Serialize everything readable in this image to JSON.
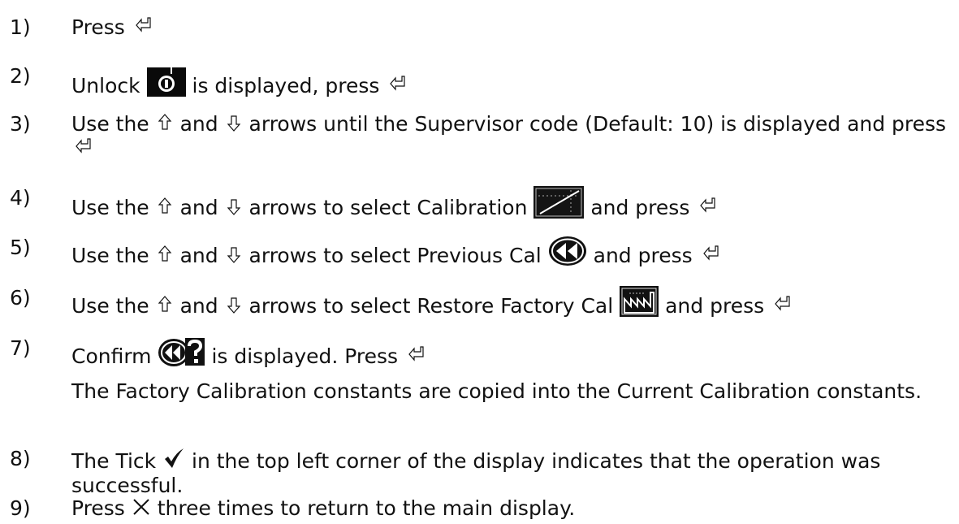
{
  "steps": [
    {
      "num": "1)",
      "parts": [
        "Press "
      ]
    },
    {
      "num": "2)",
      "parts": [
        "Unlock ",
        " is displayed, press "
      ]
    },
    {
      "num": "3)",
      "parts": [
        "Use the ",
        " and ",
        " arrows until the Supervisor code (Default: 10) is displayed and press "
      ]
    },
    {
      "num": "4)",
      "parts": [
        "Use the ",
        " and ",
        " arrows to select Calibration ",
        " and press "
      ]
    },
    {
      "num": "5)",
      "parts": [
        "Use the ",
        " and ",
        " arrows to select Previous Cal ",
        " and press "
      ]
    },
    {
      "num": "6)",
      "parts": [
        "Use the ",
        " and ",
        " arrows to select Restore Factory Cal ",
        " and press "
      ]
    },
    {
      "num": "7)",
      "parts": [
        "Confirm ",
        " is displayed. Press "
      ]
    },
    {
      "num": "8)",
      "parts": [
        "The Tick ",
        " in the top left corner of the display indicates that the operation was successful."
      ]
    },
    {
      "num": "9)",
      "parts": [
        "Press ",
        " three times to return to the main display."
      ]
    }
  ],
  "step7_note": "The Factory Calibration constants are copied into the Current Calibration constants.",
  "icons": {
    "enter": "enter-key-icon",
    "up": "up-arrow-icon",
    "down": "down-arrow-icon",
    "unlock": "unlock-padlock-icon",
    "calibration": "calibration-graph-icon",
    "previous_cal": "rewind-icon",
    "restore_factory": "factory-icon",
    "confirm": "confirm-question-icon",
    "tick": "tick-icon",
    "cancel": "cancel-x-icon"
  }
}
